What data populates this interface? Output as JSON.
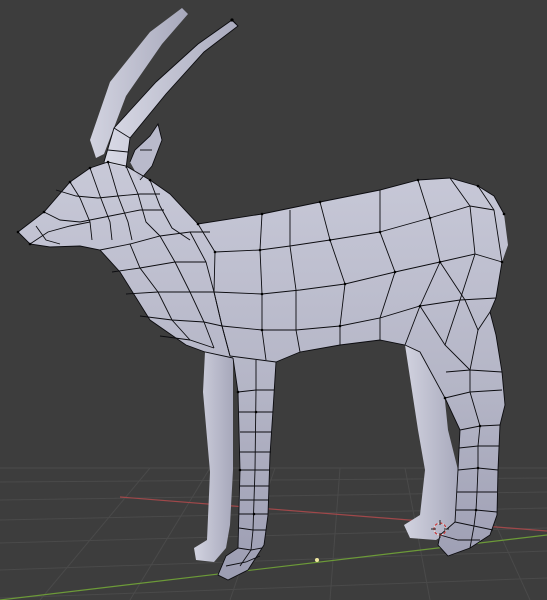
{
  "viewport": {
    "background": "#3d3d3d",
    "grid_color": "#4a4a4a",
    "x_axis_color": "#a0484a",
    "y_axis_color": "#6c9a38"
  },
  "model": {
    "subject": "antelope-mesh",
    "shading": "solid",
    "mode": "edit-mode-wireframe-overlay",
    "surface_color": "#b7b8c8",
    "edge_color": "#0c0c10"
  }
}
